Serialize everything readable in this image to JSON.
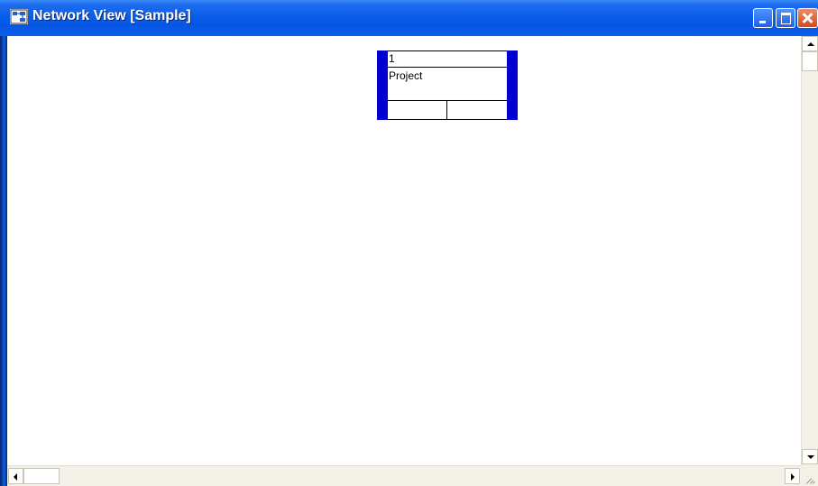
{
  "window": {
    "title": "Network View [Sample]",
    "icon": "network-view-app-icon"
  },
  "title_buttons": {
    "minimize": "minimize-icon",
    "maximize": "maximize-icon",
    "close": "close-icon"
  },
  "node": {
    "id": "1",
    "name": "Project",
    "bar_color": "#0000d0"
  },
  "scrollbars": {
    "up_arrow": "arrow-up-icon",
    "down_arrow": "arrow-down-icon",
    "left_arrow": "arrow-left-icon",
    "right_arrow": "arrow-right-icon"
  },
  "colors": {
    "titlebar": "#0a5ee8",
    "client_background": "#ffffff",
    "scrollbar_track": "#f3f1e7"
  }
}
